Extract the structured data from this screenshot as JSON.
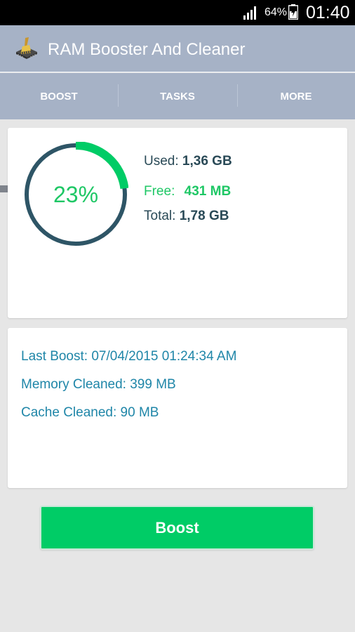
{
  "status_bar": {
    "battery_percent": "64%",
    "time": "01:40",
    "signal_icon": "signal-icon",
    "battery_icon": "battery-charging-icon"
  },
  "app": {
    "title": "RAM Booster And Cleaner",
    "icon": "broom-chip-icon"
  },
  "tabs": [
    {
      "label": "BOOST",
      "active": true
    },
    {
      "label": "TASKS",
      "active": false
    },
    {
      "label": "MORE",
      "active": false
    }
  ],
  "memory": {
    "percent_label": "23%",
    "free_fraction": 0.23,
    "used_label": "Used:",
    "used_value": "1,36 GB",
    "free_label": "Free:",
    "free_value": "431 MB",
    "total_label": "Total:",
    "total_value": "1,78 GB"
  },
  "info": {
    "last_boost": "Last Boost: 07/04/2015 01:24:34 AM",
    "memory_cleaned": "Memory Cleaned: 399 MB",
    "cache_cleaned": "Cache Cleaned: 90 MB"
  },
  "boost_button": {
    "label": "Boost"
  },
  "colors": {
    "accent_green": "#00cc66",
    "ring_dark": "#2e5566",
    "header": "#a6b2c6",
    "info_text": "#1f86a8"
  }
}
